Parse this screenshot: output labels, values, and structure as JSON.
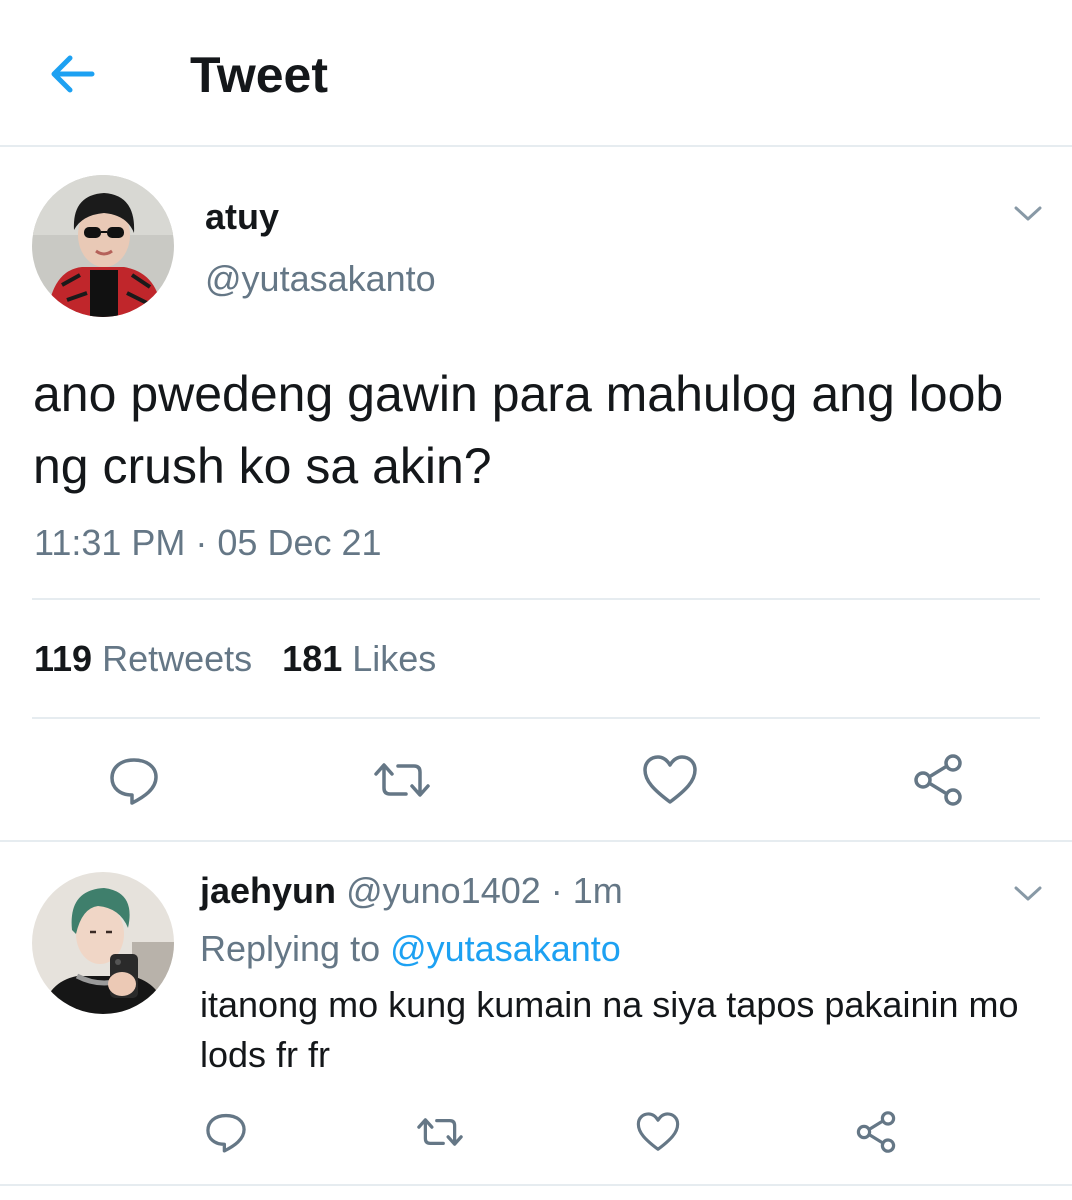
{
  "header": {
    "title": "Tweet",
    "back_icon": "arrow-left-icon"
  },
  "tweet": {
    "display_name": "atuy",
    "handle": "@yutasakanto",
    "text": "ano pwedeng gawin para mahulog ang loob ng crush ko sa akin?",
    "timestamp": "11:31 PM · 05 Dec 21",
    "retweets_count": "119",
    "retweets_label": "Retweets",
    "likes_count": "181",
    "likes_label": "Likes"
  },
  "reply": {
    "display_name": "jaehyun",
    "handle": "@yuno1402",
    "separator": " · ",
    "time": "1m",
    "replying_prefix": "Replying to ",
    "replying_to": "@yutasakanto",
    "text": "itanong mo kung kumain na siya tapos pakainin mo lods fr fr"
  },
  "colors": {
    "accent": "#1da1f2",
    "secondary_text": "#657786",
    "divider": "#e6ecf0",
    "primary_text": "#14171a"
  },
  "icons": [
    "arrow-left-icon",
    "chevron-down-icon",
    "reply-icon",
    "retweet-icon",
    "like-icon",
    "share-icon"
  ]
}
